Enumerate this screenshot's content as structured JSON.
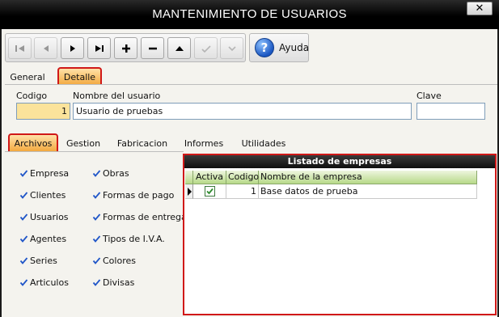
{
  "window": {
    "title": "MANTENIMIENTO DE USUARIOS",
    "close_glyph": "✕"
  },
  "toolbar": {
    "buttons": [
      {
        "icon": "first-record-icon",
        "enabled": false
      },
      {
        "icon": "previous-record-icon",
        "enabled": false
      },
      {
        "icon": "next-record-icon",
        "enabled": true
      },
      {
        "icon": "last-record-icon",
        "enabled": true
      },
      {
        "icon": "add-icon",
        "enabled": true
      },
      {
        "icon": "delete-icon",
        "enabled": true
      },
      {
        "icon": "edit-icon",
        "enabled": true
      },
      {
        "icon": "confirm-icon",
        "enabled": false
      },
      {
        "icon": "cancel-icon",
        "enabled": false
      }
    ],
    "help_label": "Ayuda",
    "help_icon_glyph": "?"
  },
  "main_tabs": [
    {
      "label": "General",
      "active": false
    },
    {
      "label": "Detalle",
      "active": true
    }
  ],
  "form": {
    "codigo_label": "Codigo",
    "codigo_value": "1",
    "nombre_label": "Nombre del usuario",
    "nombre_value": "Usuario de pruebas",
    "clave_label": "Clave",
    "clave_value": ""
  },
  "sub_tabs": [
    {
      "label": "Archivos",
      "active": true
    },
    {
      "label": "Gestion",
      "active": false
    },
    {
      "label": "Fabricacion",
      "active": false
    },
    {
      "label": "Informes",
      "active": false
    },
    {
      "label": "Utilidades",
      "active": false
    }
  ],
  "permissions": {
    "left": [
      {
        "label": "Empresa",
        "checked": true
      },
      {
        "label": "Clientes",
        "checked": true
      },
      {
        "label": "Usuarios",
        "checked": true
      },
      {
        "label": "Agentes",
        "checked": true
      },
      {
        "label": "Series",
        "checked": true
      },
      {
        "label": "Articulos",
        "checked": true
      }
    ],
    "right": [
      {
        "label": "Obras",
        "checked": true
      },
      {
        "label": "Formas de pago",
        "checked": true
      },
      {
        "label": "Formas de entrega",
        "checked": true
      },
      {
        "label": "Tipos de I.V.A.",
        "checked": true
      },
      {
        "label": "Colores",
        "checked": true
      },
      {
        "label": "Divisas",
        "checked": true
      }
    ]
  },
  "companies": {
    "title": "Listado de empresas",
    "columns": [
      "Activa",
      "Codigo",
      "Nombre de la empresa"
    ],
    "rows": [
      {
        "activa": true,
        "codigo": "1",
        "nombre": "Base datos de prueba"
      }
    ]
  },
  "colors": {
    "accent_red": "#d01818",
    "active_tab": "#f3a940",
    "grid_header": "#b7d989",
    "field_highlight": "#fbe39b"
  }
}
